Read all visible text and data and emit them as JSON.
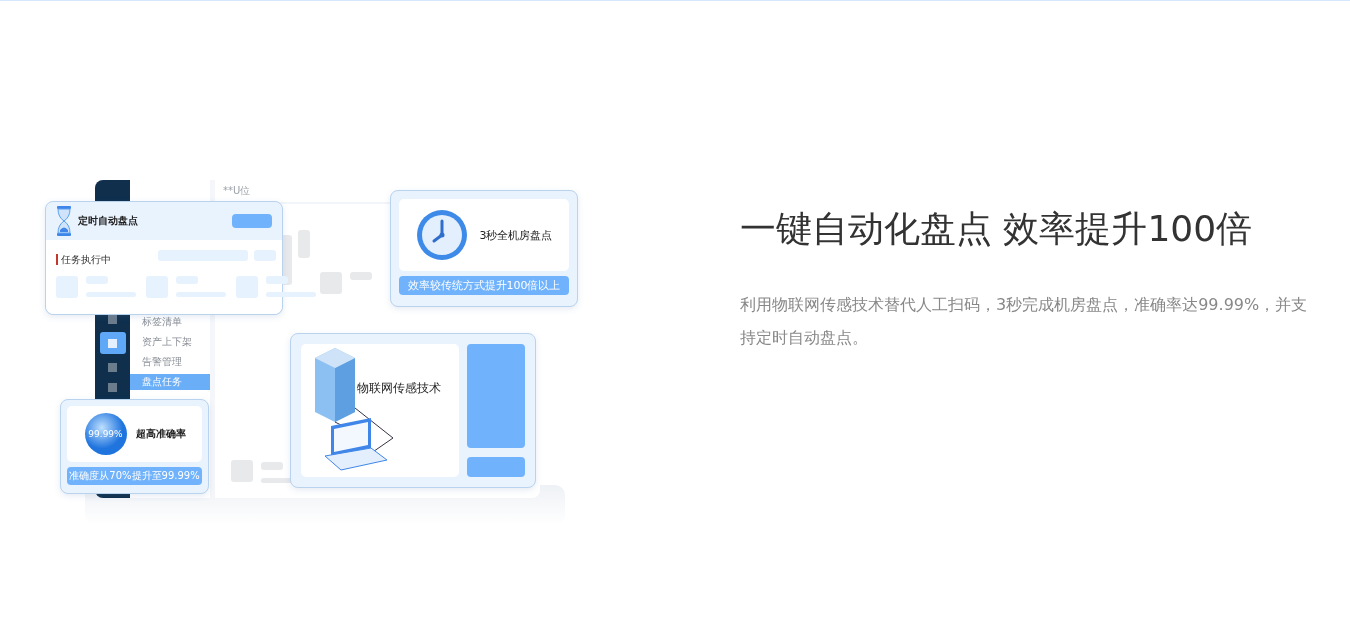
{
  "illustration": {
    "app_mock": {
      "header": "**U位",
      "sidebar_icons": [
        {
          "selected": false
        },
        {
          "selected": true
        },
        {
          "selected": false
        },
        {
          "selected": false
        }
      ],
      "menu": [
        {
          "label": "标签清单",
          "selected": false
        },
        {
          "label": "资产上下架",
          "selected": false
        },
        {
          "label": "告警管理",
          "selected": false
        },
        {
          "label": "盘点任务",
          "selected": true
        }
      ]
    },
    "cards": [
      {
        "kind": "task",
        "title": "定时自动盘点",
        "status": "任务执行中"
      },
      {
        "kind": "clock",
        "title": "3秒全机房盘点",
        "caption": "效率较传统方式提升100倍以上"
      },
      {
        "kind": "iot",
        "title": "物联网传感技术"
      },
      {
        "kind": "accuracy",
        "value": "99.99%",
        "title": "超高准确率",
        "caption": "准确度从70%提升至99.99%"
      }
    ]
  },
  "title": "一键自动化盘点 效率提升100倍",
  "description": "利用物联网传感技术替代人工扫码，3秒完成机房盘点，准确率达99.99%，并支持定时自动盘点。"
}
